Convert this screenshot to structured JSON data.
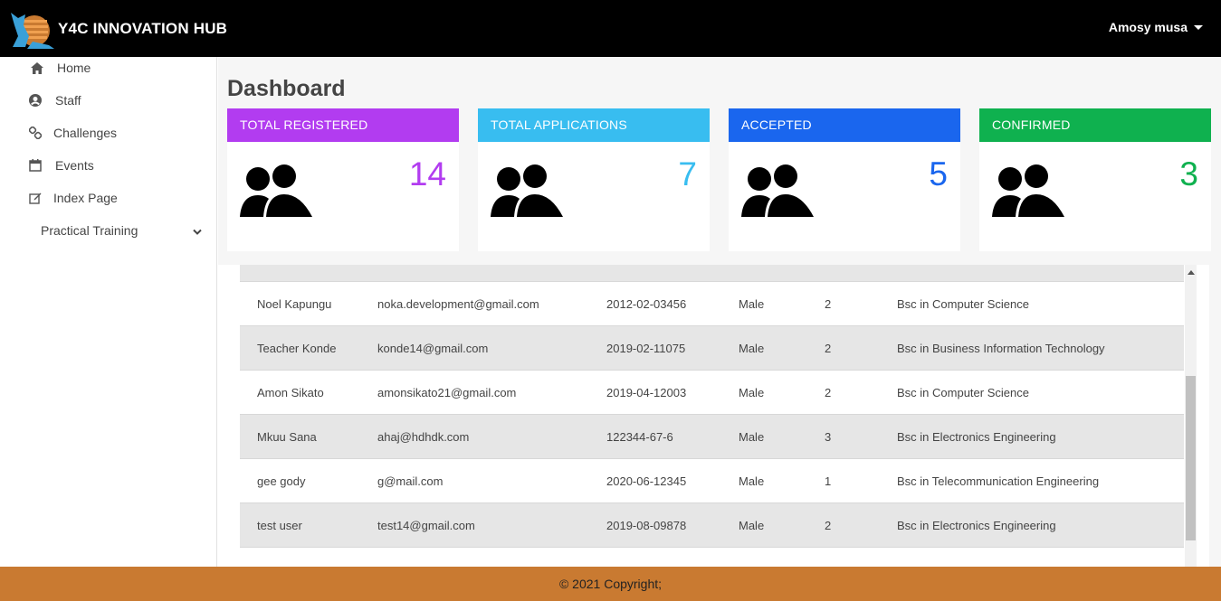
{
  "header": {
    "brand": "Y4C INNOVATION HUB",
    "user": "Amosy musa"
  },
  "sidebar": {
    "items": [
      {
        "label": "Home",
        "icon": "home-icon"
      },
      {
        "label": "Staff",
        "icon": "user-circle-icon"
      },
      {
        "label": "Challenges",
        "icon": "link-icon"
      },
      {
        "label": "Events",
        "icon": "calendar-icon"
      },
      {
        "label": "Index Page",
        "icon": "edit-icon"
      },
      {
        "label": "Practical Training",
        "icon": "chevron-down-icon"
      }
    ]
  },
  "main": {
    "title": "Dashboard",
    "cards": [
      {
        "title": "TOTAL REGISTERED",
        "value": "14",
        "color": "#b23cf0"
      },
      {
        "title": "TOTAL APPLICATIONS",
        "value": "7",
        "color": "#38bdf0"
      },
      {
        "title": "ACCEPTED",
        "value": "5",
        "color": "#1a66ee"
      },
      {
        "title": "CONFIRMED",
        "value": "3",
        "color": "#0fb14f"
      }
    ],
    "table": {
      "rows": [
        {
          "name": "Noel Kapungu",
          "email": "noka.development@gmail.com",
          "reg": "2012-02-03456",
          "gender": "Male",
          "year": "2",
          "program": "Bsc in Computer Science"
        },
        {
          "name": "Teacher Konde",
          "email": "konde14@gmail.com",
          "reg": "2019-02-11075",
          "gender": "Male",
          "year": "2",
          "program": "Bsc in Business Information Technology"
        },
        {
          "name": "Amon Sikato",
          "email": "amonsikato21@gmail.com",
          "reg": "2019-04-12003",
          "gender": "Male",
          "year": "2",
          "program": "Bsc in Computer Science"
        },
        {
          "name": "Mkuu Sana",
          "email": "ahaj@hdhdk.com",
          "reg": "122344-67-6",
          "gender": "Male",
          "year": "3",
          "program": "Bsc in Electronics Engineering"
        },
        {
          "name": "gee gody",
          "email": "g@mail.com",
          "reg": "2020-06-12345",
          "gender": "Male",
          "year": "1",
          "program": "Bsc in Telecommunication Engineering"
        },
        {
          "name": "test user",
          "email": "test14@gmail.com",
          "reg": "2019-08-09878",
          "gender": "Male",
          "year": "2",
          "program": "Bsc in Electronics Engineering"
        }
      ]
    }
  },
  "footer": {
    "text": "© 2021 Copyright;"
  }
}
